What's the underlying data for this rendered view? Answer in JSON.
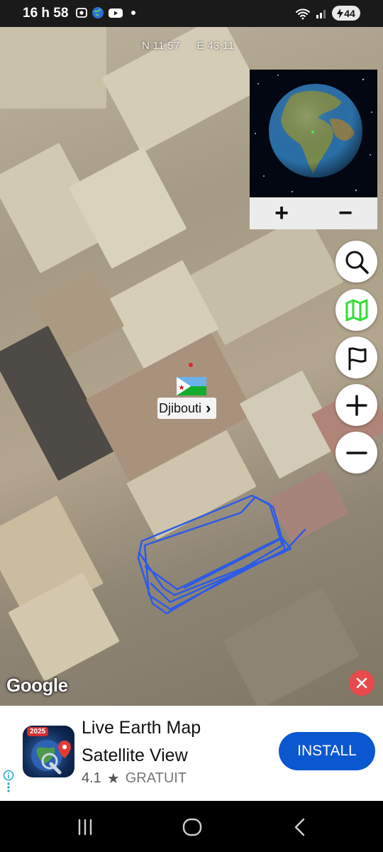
{
  "status_bar": {
    "time": "16 h 58",
    "battery": "44",
    "left_icons": [
      "screenshot-icon",
      "globe-app-icon",
      "youtube-icon",
      "notification-dot"
    ],
    "right_icons": [
      "wifi-icon",
      "signal-icon",
      "battery-charging-icon"
    ]
  },
  "map": {
    "coordinates": {
      "lat": "N 11,57",
      "lon": "E 43,11"
    },
    "place_label": "Djibouti",
    "place_chevron": "›",
    "attribution": "Google",
    "overlay_stroke_color": "#2b5be8",
    "pin_color": "#e3262b"
  },
  "globe": {
    "zoom_in": "+",
    "zoom_out": "−"
  },
  "fabs": [
    {
      "name": "search",
      "icon": "search-icon"
    },
    {
      "name": "map-type",
      "icon": "map-icon"
    },
    {
      "name": "flag",
      "icon": "flag-icon"
    },
    {
      "name": "zoom-in",
      "icon": "plus-icon"
    },
    {
      "name": "zoom-out",
      "icon": "minus-icon"
    }
  ],
  "ad": {
    "badge": "2025",
    "title_line1": "Live Earth Map",
    "title_line2": "Satellite View",
    "rating": "4.1",
    "star": "★",
    "price": "GRATUIT",
    "cta": "INSTALL",
    "accent": "#0b57d0"
  },
  "navbar": {
    "icons": [
      "recents-icon",
      "home-icon",
      "back-icon"
    ]
  }
}
